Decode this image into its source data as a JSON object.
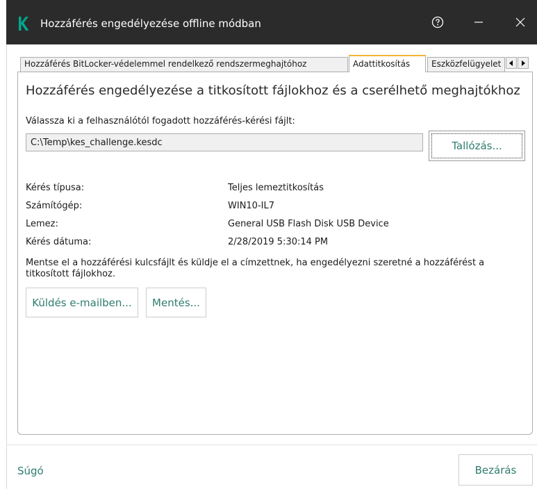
{
  "window": {
    "title": "Hozzáférés engedélyezése offline módban"
  },
  "tabs": [
    {
      "label": "Hozzáférés BitLocker-védelemmel rendelkező rendszermeghajtóhoz"
    },
    {
      "label": "Adattitkosítás"
    },
    {
      "label": "Eszközfelügyelet"
    }
  ],
  "active_tab": "Adattitkosítás",
  "main": {
    "heading": "Hozzáférés engedélyezése a titkosított fájlokhoz és a cserélhető meghajtókhoz",
    "file_label": "Válassza ki a felhasználótól fogadott hozzáférés-kérési fájlt:",
    "file_value": "C:\\Temp\\kes_challenge.kesdc",
    "browse_label": "Tallózás...",
    "info": [
      {
        "key": "Kérés típusa:",
        "value": "Teljes lemeztitkosítás"
      },
      {
        "key": "Számítógép:",
        "value": "WIN10-IL7"
      },
      {
        "key": "Lemez:",
        "value": "General USB Flash Disk USB Device"
      },
      {
        "key": "Kérés dátuma:",
        "value": "2/28/2019 5:30:14 PM"
      }
    ],
    "note": "Mentse el a hozzáférési kulcsfájlt és küldje el a címzettnek, ha engedélyezni szeretné a hozzáférést a titkosított fájlokhoz.",
    "email_label": "Küldés e-mailben...",
    "save_label": "Mentés..."
  },
  "footer": {
    "help_label": "Súgó",
    "close_label": "Bezárás"
  },
  "colors": {
    "titlebar": "#2b2b2b",
    "brand": "#00a88e",
    "link": "#2f7d6d",
    "active_tab_accent": "#f2b233"
  }
}
